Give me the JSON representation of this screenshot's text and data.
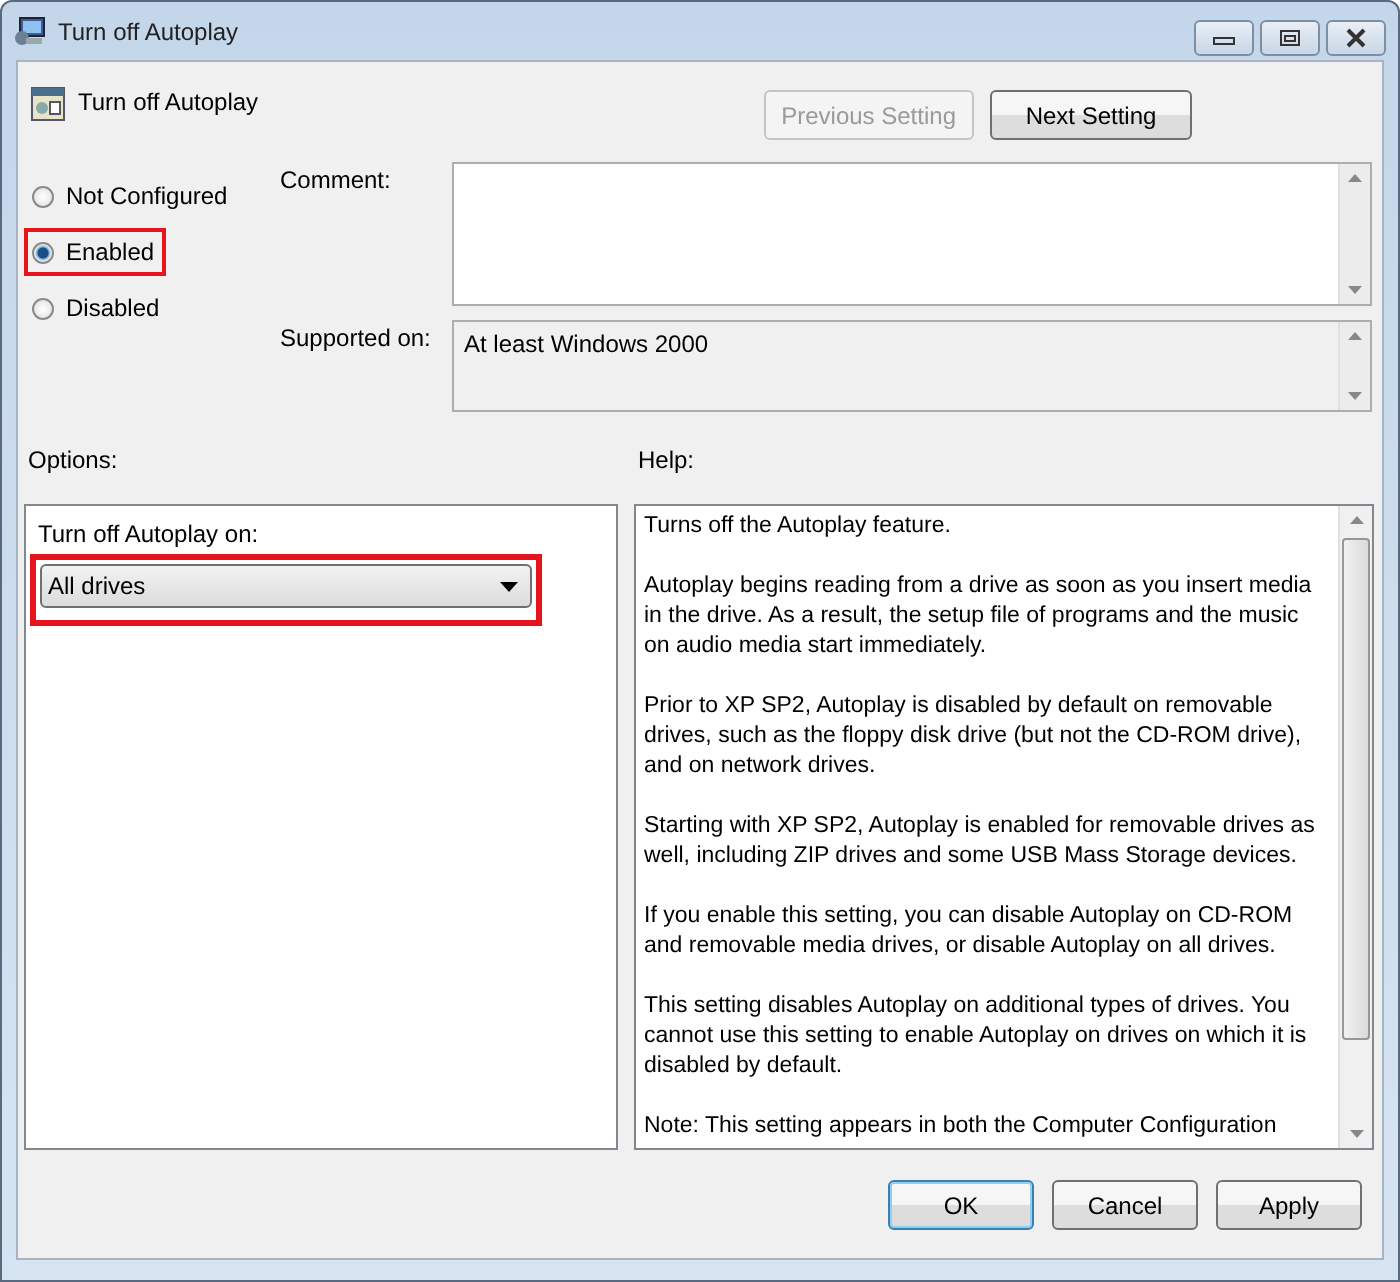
{
  "window": {
    "title": "Turn off Autoplay"
  },
  "header": {
    "title": "Turn off Autoplay"
  },
  "nav_buttons": [
    {
      "label": "Previous Setting",
      "disabled": true
    },
    {
      "label": "Next Setting",
      "disabled": false
    }
  ],
  "state_options": [
    {
      "label": "Not Configured",
      "selected": false,
      "highlighted": false
    },
    {
      "label": "Enabled",
      "selected": true,
      "highlighted": true
    },
    {
      "label": "Disabled",
      "selected": false,
      "highlighted": false
    }
  ],
  "comment": {
    "label": "Comment:"
  },
  "supported_on": {
    "label": "Supported on:",
    "value": "At least Windows 2000"
  },
  "options": {
    "label": "Options:",
    "field_label": "Turn off Autoplay on:",
    "dropdown": {
      "value": "All drives",
      "highlighted": true
    }
  },
  "help": {
    "label": "Help:",
    "paragraphs": [
      "Turns off the Autoplay feature.",
      "Autoplay begins reading from a drive as soon as you insert media in the drive. As a result, the setup file of programs and the music on audio media start immediately.",
      "Prior to XP SP2, Autoplay is disabled by default on removable drives, such as the floppy disk drive (but not the CD-ROM drive), and on network drives.",
      "Starting with XP SP2, Autoplay is enabled for removable drives as well, including ZIP drives and some USB Mass Storage devices.",
      "If you enable this setting, you can disable Autoplay on CD-ROM and removable media drives, or disable Autoplay on all drives.",
      "This setting disables Autoplay on additional types of drives. You cannot use this setting to enable Autoplay on drives on which it is disabled by default.",
      "Note: This setting appears in both the Computer Configuration"
    ]
  },
  "buttons": [
    {
      "label": "OK",
      "default": true
    },
    {
      "label": "Cancel",
      "default": false
    },
    {
      "label": "Apply",
      "default": false
    }
  ]
}
